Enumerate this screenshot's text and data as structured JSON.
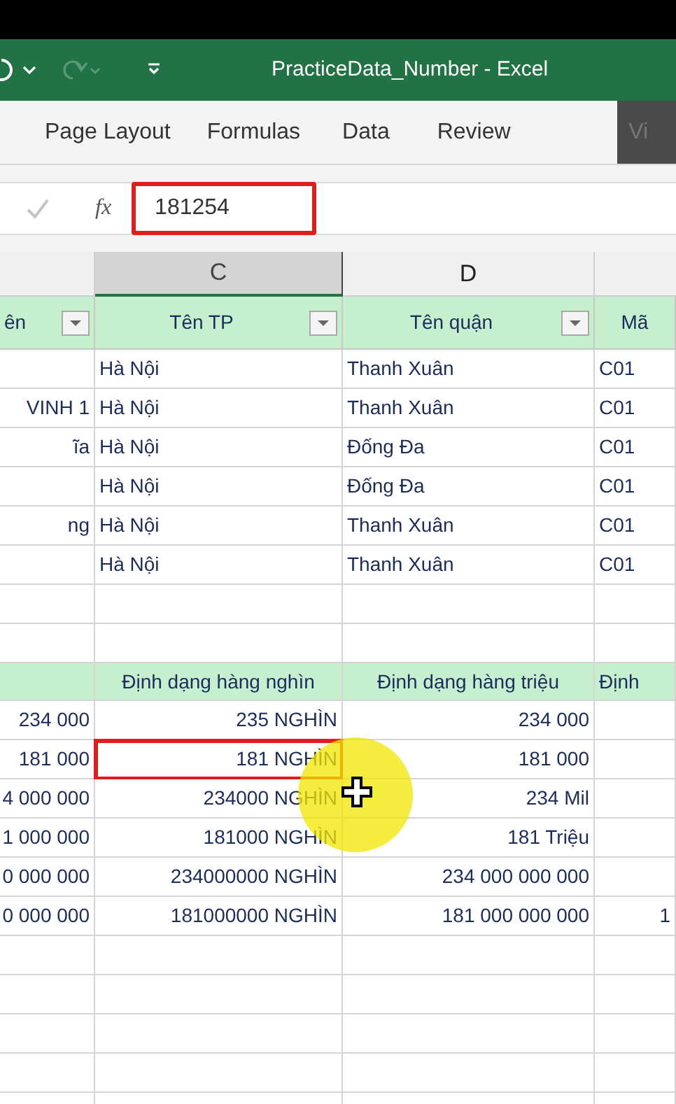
{
  "title_bar": {
    "title": "PracticeData_Number  -  Excel"
  },
  "ribbon_tabs": [
    {
      "label": "Page Layout",
      "kind": "plain"
    },
    {
      "label": "Formulas",
      "kind": "plain"
    },
    {
      "label": "Data",
      "kind": "plain"
    },
    {
      "label": "Review",
      "kind": "plain"
    },
    {
      "label": "Vi",
      "kind": "covered"
    }
  ],
  "formula_bar": {
    "function_label": "fx",
    "value": "181254",
    "highlighted": true
  },
  "column_headers": [
    {
      "letter": "C",
      "selected": true
    },
    {
      "letter": "D",
      "selected": false
    }
  ],
  "table_1": {
    "header": [
      {
        "text": "ên",
        "filter": true
      },
      {
        "text": "Tên TP",
        "filter": true
      },
      {
        "text": "Tên quận",
        "filter": true
      },
      {
        "text": "Mã",
        "filter": false
      }
    ],
    "rows": [
      {
        "col_c": "Hà Nội",
        "col_d": "Thanh Xuân",
        "col_e": "C01"
      },
      {
        "col_b": "VINH 1",
        "col_c": "Hà Nội",
        "col_d": "Thanh Xuân",
        "col_e": "C01"
      },
      {
        "col_b": "ĩa",
        "col_c": "Hà Nội",
        "col_d": "Đống Đa",
        "col_e": "C01"
      },
      {
        "col_c": "Hà Nội",
        "col_d": "Đống Đa",
        "col_e": "C01"
      },
      {
        "col_b": "ng",
        "col_c": "Hà Nội",
        "col_d": "Thanh Xuân",
        "col_e": "C01"
      },
      {
        "col_c": "Hà Nội",
        "col_d": "Thanh Xuân",
        "col_e": "C01"
      }
    ]
  },
  "table_2": {
    "header": [
      {
        "text": "Định dạng hàng nghìn"
      },
      {
        "text": "Định dạng hàng triệu"
      },
      {
        "text": "Định"
      }
    ],
    "rows": [
      {
        "col_b": "234 000",
        "col_c": "235 NGHÌN",
        "col_d": "234 000",
        "selected": false
      },
      {
        "col_b": "181 000",
        "col_c": "181 NGHÌN",
        "col_d": "181 000",
        "selected": true
      },
      {
        "col_b": "4 000 000",
        "col_c": "234000 NGHÌN",
        "col_d": "234 Mil",
        "selected": false
      },
      {
        "col_b": "1 000 000",
        "col_c": "181000 NGHÌN",
        "col_d": "181 Triệu",
        "selected": false
      },
      {
        "col_b": "0 000 000",
        "col_c": "234000000 NGHÌN",
        "col_d": "234 000 000 000",
        "selected": false
      },
      {
        "col_b": "0 000 000",
        "col_c": "181000000 NGHÌN",
        "col_d": "181 000 000 000",
        "col_e": "1",
        "selected": false
      }
    ]
  }
}
